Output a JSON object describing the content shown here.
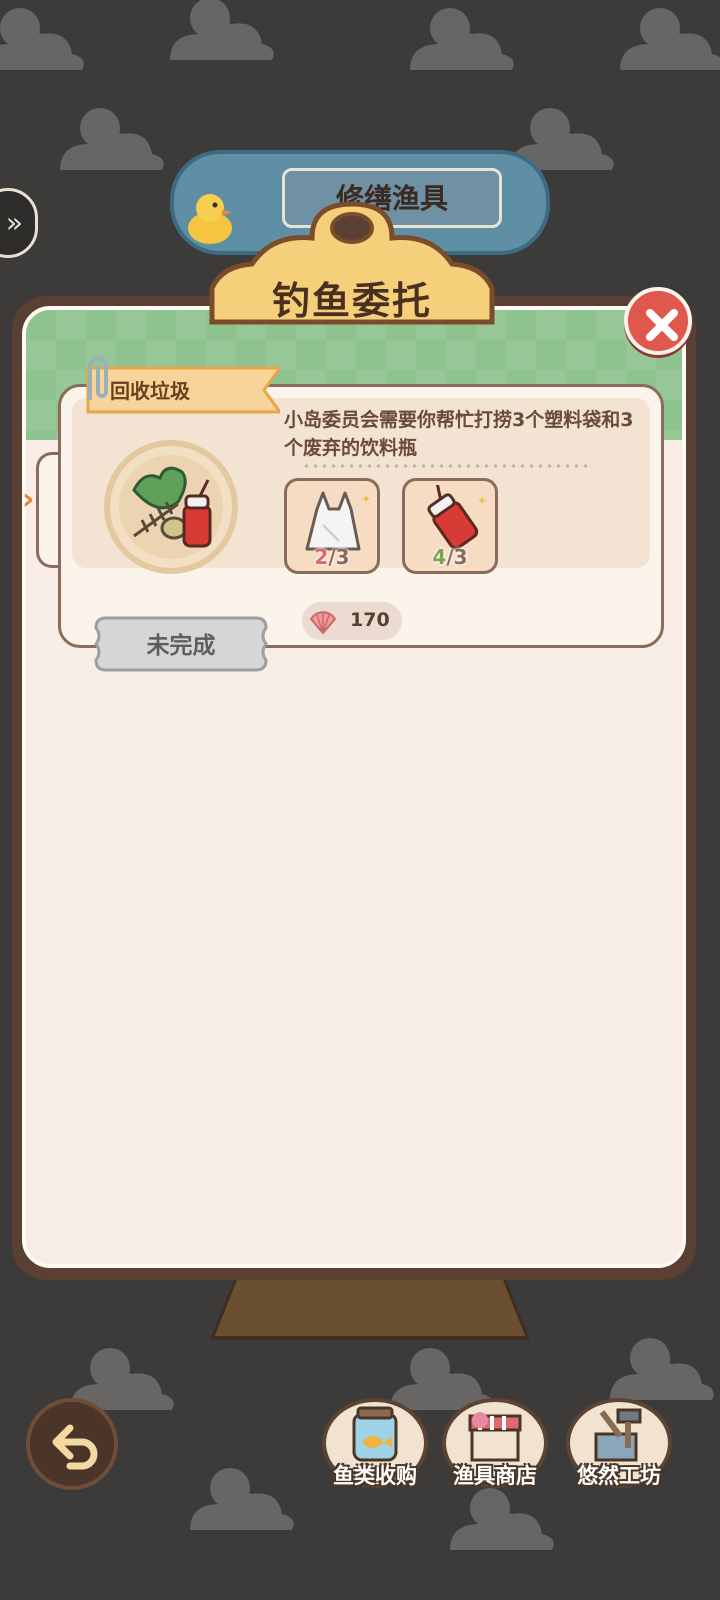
{
  "background": {
    "banner_label": "修缮渔具"
  },
  "panel": {
    "title": "钓鱼委托",
    "close_icon": "close-x-icon"
  },
  "task": {
    "category": "回收垃圾",
    "description": "小岛委员会需要你帮忙打捞3个塑料袋和3个废弃的饮料瓶",
    "items": [
      {
        "icon": "plastic-bag-icon",
        "have": "2",
        "need": "3",
        "separator": "/",
        "state": "short"
      },
      {
        "icon": "soda-cup-icon",
        "have": "4",
        "need": "3",
        "separator": "/",
        "state": "done"
      }
    ],
    "reward": {
      "icon": "shell-icon",
      "value": "170"
    },
    "status": "未完成"
  },
  "bottom_nav": {
    "back_icon": "back-arrow-icon",
    "buttons": [
      {
        "label": "鱼类收购",
        "icon": "fish-jar-icon"
      },
      {
        "label": "渔具商店",
        "icon": "shop-stall-icon"
      },
      {
        "label": "悠然工坊",
        "icon": "workshop-tools-icon"
      }
    ]
  },
  "colors": {
    "background": "#3d3b3a",
    "panel_border": "#5a3f33",
    "panel_green": "#8ec28e",
    "close_red": "#e0574e",
    "count_short": "#e1676a",
    "count_done": "#7ca54a"
  }
}
